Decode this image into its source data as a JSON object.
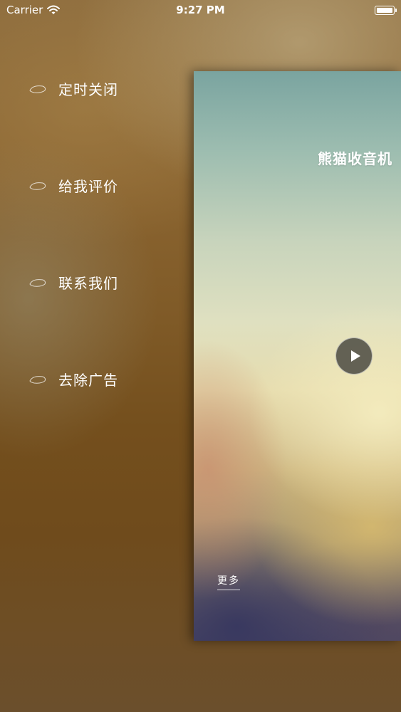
{
  "status_bar": {
    "carrier": "Carrier",
    "time": "9:27 PM",
    "wifi_icon": "wifi-icon",
    "battery_icon": "battery-icon"
  },
  "menu": {
    "items": [
      {
        "label": "定时关闭",
        "icon": "leaf-icon"
      },
      {
        "label": "给我评价",
        "icon": "leaf-icon"
      },
      {
        "label": "联系我们",
        "icon": "leaf-icon"
      },
      {
        "label": "去除广告",
        "icon": "leaf-icon"
      }
    ]
  },
  "main": {
    "title": "熊猫收音机",
    "play_icon": "play-icon",
    "more_label": "更多"
  }
}
